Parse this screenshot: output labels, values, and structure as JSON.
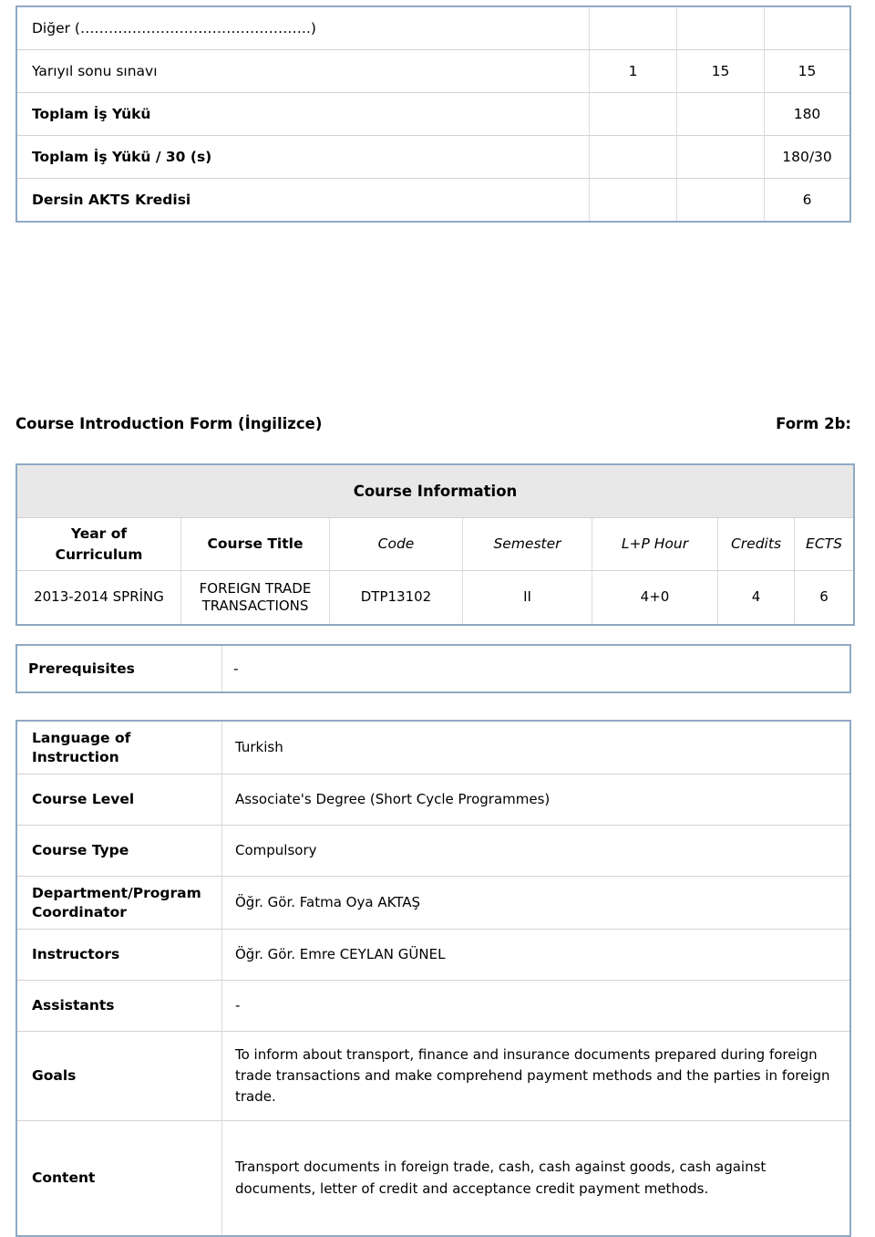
{
  "workload_table": {
    "rows": [
      {
        "label": "Diğer (………………………………………….)",
        "c1": "",
        "c2": "",
        "c3": "",
        "bold": false
      },
      {
        "label": "Yarıyıl sonu sınavı",
        "c1": "1",
        "c2": "15",
        "c3": "15",
        "bold": false
      },
      {
        "label": "Toplam İş Yükü",
        "c1": "",
        "c2": "",
        "c3": "180",
        "bold": true
      },
      {
        "label": "Toplam İş Yükü / 30 (s)",
        "c1": "",
        "c2": "",
        "c3": "180/30",
        "bold": true
      },
      {
        "label": "Dersin AKTS Kredisi",
        "c1": "",
        "c2": "",
        "c3": "6",
        "bold": true
      }
    ]
  },
  "form_heading": {
    "title": "Course Introduction Form (İngilizce)",
    "form_no": "Form 2b:"
  },
  "course_info": {
    "band_title": "Course Information",
    "headers": [
      {
        "label": "Year of Curriculum",
        "style": "bold"
      },
      {
        "label": "Course Title",
        "style": "bold"
      },
      {
        "label": "Code",
        "style": "italic"
      },
      {
        "label": "Semester",
        "style": "italic"
      },
      {
        "label": "L+P Hour",
        "style": "italic"
      },
      {
        "label": "Credits",
        "style": "italic"
      },
      {
        "label": "ECTS",
        "style": "italic"
      }
    ],
    "row": {
      "year_of_curriculum": "2013-2014 SPRİNG",
      "course_title": "FOREIGN TRADE TRANSACTIONS",
      "code": "DTP13102",
      "semester": "II",
      "lp_hour": "4+0",
      "credits": "4",
      "ects": "6"
    }
  },
  "prerequisites": {
    "label": "Prerequisites",
    "value": "-"
  },
  "details": {
    "rows": [
      {
        "label": "Language of Instruction",
        "value": "Turkish"
      },
      {
        "label": "Course Level",
        "value": "Associate's Degree (Short Cycle Programmes)"
      },
      {
        "label": "Course Type",
        "value": "Compulsory"
      },
      {
        "label": "Department/Program Coordinator",
        "value": "Öğr. Gör. Fatma Oya AKTAŞ"
      },
      {
        "label": "Instructors",
        "value": "Öğr. Gör. Emre CEYLAN GÜNEL"
      },
      {
        "label": "Assistants",
        "value": "-"
      },
      {
        "label": "Goals",
        "value": "To inform about transport, finance and insurance documents prepared during foreign trade transactions and make  comprehend payment methods and the parties in foreign trade."
      },
      {
        "label": "Content",
        "value": "Transport documents in foreign trade, cash, cash against goods, cash against documents, letter of credit and acceptance credit payment methods."
      }
    ]
  },
  "colors": {
    "table_border": "#8fa9c4",
    "cell_border": "#dcdcdc",
    "band_background": "#e8e8e8",
    "text": "#000000"
  }
}
